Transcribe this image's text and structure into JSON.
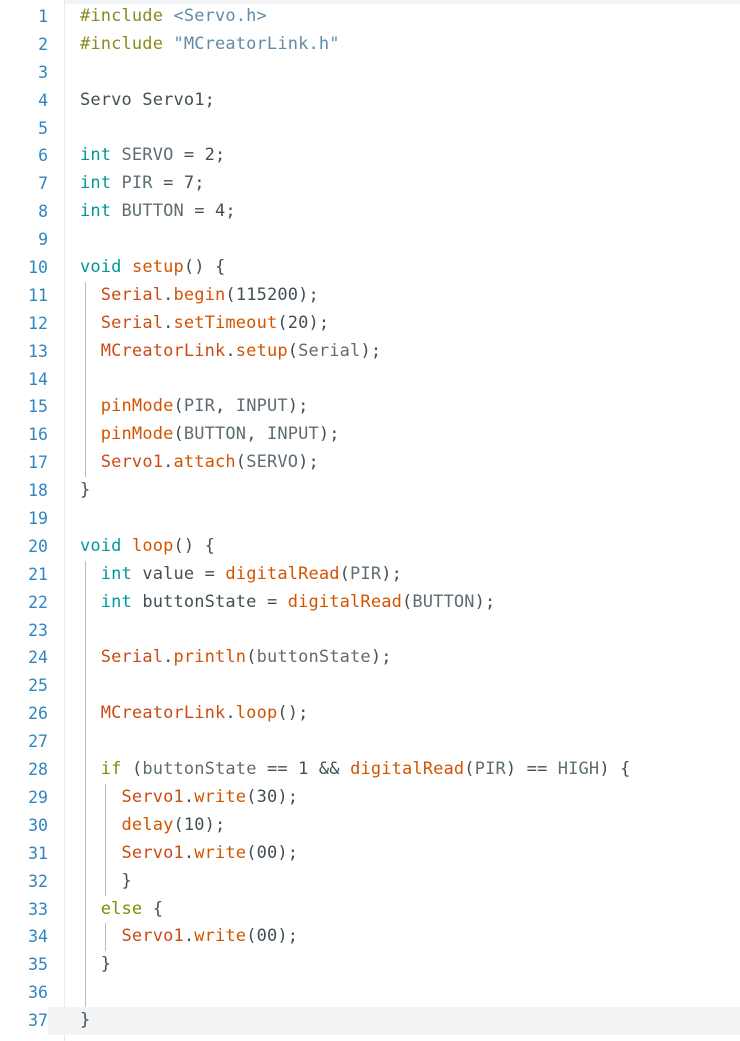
{
  "editor": {
    "title": "Arduino Sketch Code Editor",
    "language": "arduino-cpp",
    "total_lines": 37,
    "current_line": 37,
    "colors": {
      "background": "#ffffff",
      "line_number": "#2e86c1",
      "gutter_divider": "#e8eaeb",
      "current_line_highlight": "#f2f3f4",
      "indent_guide": "#b9bcbe",
      "preprocessor": "#8a8a20",
      "include_path": "#5f8ca8",
      "type_keyword": "#00979c",
      "function": "#d35400",
      "class_name": "#cb4b16",
      "control_keyword": "#7e8c00",
      "identifier": "#434f54",
      "constant": "#5e6d75"
    }
  },
  "code": {
    "plain_text": "#include <Servo.h>\n#include \"MCreatorLink.h\"\n\nServo Servo1;\n\nint SERVO = 2;\nint PIR = 7;\nint BUTTON = 4;\n\nvoid setup() {\n  Serial.begin(115200);\n  Serial.setTimeout(20);\n  MCreatorLink.setup(Serial);\n\n  pinMode(PIR, INPUT);\n  pinMode(BUTTON, INPUT);\n  Servo1.attach(SERVO);\n}\n\nvoid loop() {\n  int value = digitalRead(PIR);\n  int buttonState = digitalRead(BUTTON);\n\n  Serial.println(buttonState);\n\n  MCreatorLink.loop();\n\n  if (buttonState == 1 && digitalRead(PIR) == HIGH) {\n    Servo1.write(30);\n    delay(10);\n    Servo1.write(00);\n    }\n  else {\n    Servo1.write(00);\n  }\n\n}",
    "lines": [
      {
        "n": 1,
        "guides": 0,
        "current": false,
        "tokens": [
          {
            "t": "#include ",
            "c": "t-pre"
          },
          {
            "t": "<Servo.h>",
            "c": "t-inc"
          }
        ]
      },
      {
        "n": 2,
        "guides": 0,
        "current": false,
        "tokens": [
          {
            "t": "#include ",
            "c": "t-pre"
          },
          {
            "t": "\"MCreatorLink.h\"",
            "c": "t-inc"
          }
        ]
      },
      {
        "n": 3,
        "guides": 0,
        "current": false,
        "tokens": []
      },
      {
        "n": 4,
        "guides": 0,
        "current": false,
        "tokens": [
          {
            "t": "Servo Servo1;",
            "c": "t-id"
          }
        ]
      },
      {
        "n": 5,
        "guides": 0,
        "current": false,
        "tokens": []
      },
      {
        "n": 6,
        "guides": 0,
        "current": false,
        "tokens": [
          {
            "t": "int",
            "c": "t-type"
          },
          {
            "t": " SERVO ",
            "c": "t-const"
          },
          {
            "t": "= ",
            "c": "t-punc"
          },
          {
            "t": "2",
            "c": "t-num"
          },
          {
            "t": ";",
            "c": "t-punc"
          }
        ]
      },
      {
        "n": 7,
        "guides": 0,
        "current": false,
        "tokens": [
          {
            "t": "int",
            "c": "t-type"
          },
          {
            "t": " PIR ",
            "c": "t-const"
          },
          {
            "t": "= ",
            "c": "t-punc"
          },
          {
            "t": "7",
            "c": "t-num"
          },
          {
            "t": ";",
            "c": "t-punc"
          }
        ]
      },
      {
        "n": 8,
        "guides": 0,
        "current": false,
        "tokens": [
          {
            "t": "int",
            "c": "t-type"
          },
          {
            "t": " BUTTON ",
            "c": "t-const"
          },
          {
            "t": "= ",
            "c": "t-punc"
          },
          {
            "t": "4",
            "c": "t-num"
          },
          {
            "t": ";",
            "c": "t-punc"
          }
        ]
      },
      {
        "n": 9,
        "guides": 0,
        "current": false,
        "tokens": []
      },
      {
        "n": 10,
        "guides": 0,
        "current": false,
        "tokens": [
          {
            "t": "void",
            "c": "t-type"
          },
          {
            "t": " ",
            "c": "t-punc"
          },
          {
            "t": "setup",
            "c": "t-func"
          },
          {
            "t": "() {",
            "c": "t-punc"
          }
        ]
      },
      {
        "n": 11,
        "guides": 1,
        "current": false,
        "tokens": [
          {
            "t": "  ",
            "c": "t-punc"
          },
          {
            "t": "Serial",
            "c": "t-cls"
          },
          {
            "t": ".",
            "c": "t-punc"
          },
          {
            "t": "begin",
            "c": "t-func"
          },
          {
            "t": "(",
            "c": "t-punc"
          },
          {
            "t": "115200",
            "c": "t-num"
          },
          {
            "t": ");",
            "c": "t-punc"
          }
        ]
      },
      {
        "n": 12,
        "guides": 1,
        "current": false,
        "tokens": [
          {
            "t": "  ",
            "c": "t-punc"
          },
          {
            "t": "Serial",
            "c": "t-cls"
          },
          {
            "t": ".",
            "c": "t-punc"
          },
          {
            "t": "setTimeout",
            "c": "t-func"
          },
          {
            "t": "(",
            "c": "t-punc"
          },
          {
            "t": "20",
            "c": "t-num"
          },
          {
            "t": ");",
            "c": "t-punc"
          }
        ]
      },
      {
        "n": 13,
        "guides": 1,
        "current": false,
        "tokens": [
          {
            "t": "  ",
            "c": "t-punc"
          },
          {
            "t": "MCreatorLink",
            "c": "t-cls"
          },
          {
            "t": ".",
            "c": "t-punc"
          },
          {
            "t": "setup",
            "c": "t-func"
          },
          {
            "t": "(",
            "c": "t-punc"
          },
          {
            "t": "Serial",
            "c": "t-const"
          },
          {
            "t": ");",
            "c": "t-punc"
          }
        ]
      },
      {
        "n": 14,
        "guides": 1,
        "current": false,
        "tokens": []
      },
      {
        "n": 15,
        "guides": 1,
        "current": false,
        "tokens": [
          {
            "t": "  ",
            "c": "t-punc"
          },
          {
            "t": "pinMode",
            "c": "t-func"
          },
          {
            "t": "(",
            "c": "t-punc"
          },
          {
            "t": "PIR",
            "c": "t-const"
          },
          {
            "t": ", ",
            "c": "t-punc"
          },
          {
            "t": "INPUT",
            "c": "t-const"
          },
          {
            "t": ");",
            "c": "t-punc"
          }
        ]
      },
      {
        "n": 16,
        "guides": 1,
        "current": false,
        "tokens": [
          {
            "t": "  ",
            "c": "t-punc"
          },
          {
            "t": "pinMode",
            "c": "t-func"
          },
          {
            "t": "(",
            "c": "t-punc"
          },
          {
            "t": "BUTTON",
            "c": "t-const"
          },
          {
            "t": ", ",
            "c": "t-punc"
          },
          {
            "t": "INPUT",
            "c": "t-const"
          },
          {
            "t": ");",
            "c": "t-punc"
          }
        ]
      },
      {
        "n": 17,
        "guides": 1,
        "current": false,
        "tokens": [
          {
            "t": "  ",
            "c": "t-punc"
          },
          {
            "t": "Servo1",
            "c": "t-cls"
          },
          {
            "t": ".",
            "c": "t-punc"
          },
          {
            "t": "attach",
            "c": "t-func"
          },
          {
            "t": "(",
            "c": "t-punc"
          },
          {
            "t": "SERVO",
            "c": "t-const"
          },
          {
            "t": ");",
            "c": "t-punc"
          }
        ]
      },
      {
        "n": 18,
        "guides": 0,
        "current": false,
        "tokens": [
          {
            "t": "}",
            "c": "t-punc"
          }
        ]
      },
      {
        "n": 19,
        "guides": 0,
        "current": false,
        "tokens": []
      },
      {
        "n": 20,
        "guides": 0,
        "current": false,
        "tokens": [
          {
            "t": "void",
            "c": "t-type"
          },
          {
            "t": " ",
            "c": "t-punc"
          },
          {
            "t": "loop",
            "c": "t-func"
          },
          {
            "t": "() {",
            "c": "t-punc"
          }
        ]
      },
      {
        "n": 21,
        "guides": 1,
        "current": false,
        "tokens": [
          {
            "t": "  ",
            "c": "t-punc"
          },
          {
            "t": "int",
            "c": "t-type"
          },
          {
            "t": " value ",
            "c": "t-id"
          },
          {
            "t": "= ",
            "c": "t-punc"
          },
          {
            "t": "digitalRead",
            "c": "t-func"
          },
          {
            "t": "(",
            "c": "t-punc"
          },
          {
            "t": "PIR",
            "c": "t-const"
          },
          {
            "t": ");",
            "c": "t-punc"
          }
        ]
      },
      {
        "n": 22,
        "guides": 1,
        "current": false,
        "tokens": [
          {
            "t": "  ",
            "c": "t-punc"
          },
          {
            "t": "int",
            "c": "t-type"
          },
          {
            "t": " buttonState ",
            "c": "t-id"
          },
          {
            "t": "= ",
            "c": "t-punc"
          },
          {
            "t": "digitalRead",
            "c": "t-func"
          },
          {
            "t": "(",
            "c": "t-punc"
          },
          {
            "t": "BUTTON",
            "c": "t-const"
          },
          {
            "t": ");",
            "c": "t-punc"
          }
        ]
      },
      {
        "n": 23,
        "guides": 1,
        "current": false,
        "tokens": []
      },
      {
        "n": 24,
        "guides": 1,
        "current": false,
        "tokens": [
          {
            "t": "  ",
            "c": "t-punc"
          },
          {
            "t": "Serial",
            "c": "t-cls"
          },
          {
            "t": ".",
            "c": "t-punc"
          },
          {
            "t": "println",
            "c": "t-func"
          },
          {
            "t": "(",
            "c": "t-punc"
          },
          {
            "t": "buttonState",
            "c": "t-const"
          },
          {
            "t": ");",
            "c": "t-punc"
          }
        ]
      },
      {
        "n": 25,
        "guides": 1,
        "current": false,
        "tokens": []
      },
      {
        "n": 26,
        "guides": 1,
        "current": false,
        "tokens": [
          {
            "t": "  ",
            "c": "t-punc"
          },
          {
            "t": "MCreatorLink",
            "c": "t-cls"
          },
          {
            "t": ".",
            "c": "t-punc"
          },
          {
            "t": "loop",
            "c": "t-func"
          },
          {
            "t": "();",
            "c": "t-punc"
          }
        ]
      },
      {
        "n": 27,
        "guides": 1,
        "current": false,
        "tokens": []
      },
      {
        "n": 28,
        "guides": 1,
        "current": false,
        "tokens": [
          {
            "t": "  ",
            "c": "t-punc"
          },
          {
            "t": "if",
            "c": "t-key"
          },
          {
            "t": " (",
            "c": "t-punc"
          },
          {
            "t": "buttonState",
            "c": "t-const"
          },
          {
            "t": " == ",
            "c": "t-punc"
          },
          {
            "t": "1",
            "c": "t-num"
          },
          {
            "t": " && ",
            "c": "t-punc"
          },
          {
            "t": "digitalRead",
            "c": "t-func"
          },
          {
            "t": "(",
            "c": "t-punc"
          },
          {
            "t": "PIR",
            "c": "t-const"
          },
          {
            "t": ") == ",
            "c": "t-punc"
          },
          {
            "t": "HIGH",
            "c": "t-const"
          },
          {
            "t": ") {",
            "c": "t-punc"
          }
        ]
      },
      {
        "n": 29,
        "guides": 2,
        "current": false,
        "tokens": [
          {
            "t": "    ",
            "c": "t-punc"
          },
          {
            "t": "Servo1",
            "c": "t-cls"
          },
          {
            "t": ".",
            "c": "t-punc"
          },
          {
            "t": "write",
            "c": "t-func"
          },
          {
            "t": "(",
            "c": "t-punc"
          },
          {
            "t": "30",
            "c": "t-num"
          },
          {
            "t": ");",
            "c": "t-punc"
          }
        ]
      },
      {
        "n": 30,
        "guides": 2,
        "current": false,
        "tokens": [
          {
            "t": "    ",
            "c": "t-punc"
          },
          {
            "t": "delay",
            "c": "t-func"
          },
          {
            "t": "(",
            "c": "t-punc"
          },
          {
            "t": "10",
            "c": "t-num"
          },
          {
            "t": ");",
            "c": "t-punc"
          }
        ]
      },
      {
        "n": 31,
        "guides": 2,
        "current": false,
        "tokens": [
          {
            "t": "    ",
            "c": "t-punc"
          },
          {
            "t": "Servo1",
            "c": "t-cls"
          },
          {
            "t": ".",
            "c": "t-punc"
          },
          {
            "t": "write",
            "c": "t-func"
          },
          {
            "t": "(",
            "c": "t-punc"
          },
          {
            "t": "00",
            "c": "t-num"
          },
          {
            "t": ");",
            "c": "t-punc"
          }
        ]
      },
      {
        "n": 32,
        "guides": 2,
        "current": false,
        "tokens": [
          {
            "t": "    }",
            "c": "t-punc"
          }
        ]
      },
      {
        "n": 33,
        "guides": 1,
        "current": false,
        "tokens": [
          {
            "t": "  ",
            "c": "t-punc"
          },
          {
            "t": "else",
            "c": "t-key"
          },
          {
            "t": " {",
            "c": "t-punc"
          }
        ]
      },
      {
        "n": 34,
        "guides": 2,
        "current": false,
        "tokens": [
          {
            "t": "    ",
            "c": "t-punc"
          },
          {
            "t": "Servo1",
            "c": "t-cls"
          },
          {
            "t": ".",
            "c": "t-punc"
          },
          {
            "t": "write",
            "c": "t-func"
          },
          {
            "t": "(",
            "c": "t-punc"
          },
          {
            "t": "00",
            "c": "t-num"
          },
          {
            "t": ");",
            "c": "t-punc"
          }
        ]
      },
      {
        "n": 35,
        "guides": 1,
        "current": false,
        "tokens": [
          {
            "t": "  }",
            "c": "t-punc"
          }
        ]
      },
      {
        "n": 36,
        "guides": 1,
        "current": false,
        "tokens": []
      },
      {
        "n": 37,
        "guides": 0,
        "current": true,
        "tokens": [
          {
            "t": "}",
            "c": "t-punc"
          }
        ]
      }
    ]
  }
}
